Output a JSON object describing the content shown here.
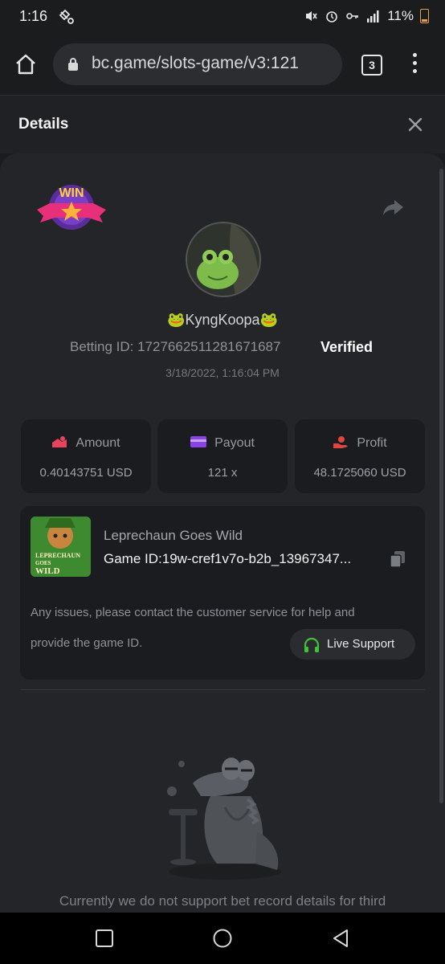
{
  "status_bar": {
    "time": "1:16",
    "battery": "11%"
  },
  "browser": {
    "url": "bc.game/slots-game/v3:121",
    "tab_count": "3"
  },
  "dialog": {
    "title": "Details"
  },
  "badge": {
    "text": "WIN"
  },
  "player": {
    "name": "🐸KyngKoopa🐸",
    "betting_id": "Betting ID: 1727662511281671687",
    "verified": "Verified",
    "date": "3/18/2022, 1:16:04 PM"
  },
  "stats": [
    {
      "label": "Amount",
      "value": "0.40143751 USD",
      "color": "#e8425e"
    },
    {
      "label": "Payout",
      "value": "121 x",
      "color": "#8a43e6"
    },
    {
      "label": "Profit",
      "value": "48.1725060 USD",
      "color": "#e0453e"
    }
  ],
  "game": {
    "name": "Leprechaun Goes Wild",
    "game_id": "Game ID:19w-cref1v7o-b2b_13967347...",
    "thumb_lines": [
      "LEPRECHAUN",
      "GOES",
      "WILD"
    ]
  },
  "support": {
    "line1": "Any issues, please contact the customer service for help and",
    "line2": "provide the game ID.",
    "button": "Live Support"
  },
  "notice": "Currently we do not support bet record details for third",
  "colors": {
    "accent_green": "#3fc13b",
    "verified": "#ffffff"
  }
}
